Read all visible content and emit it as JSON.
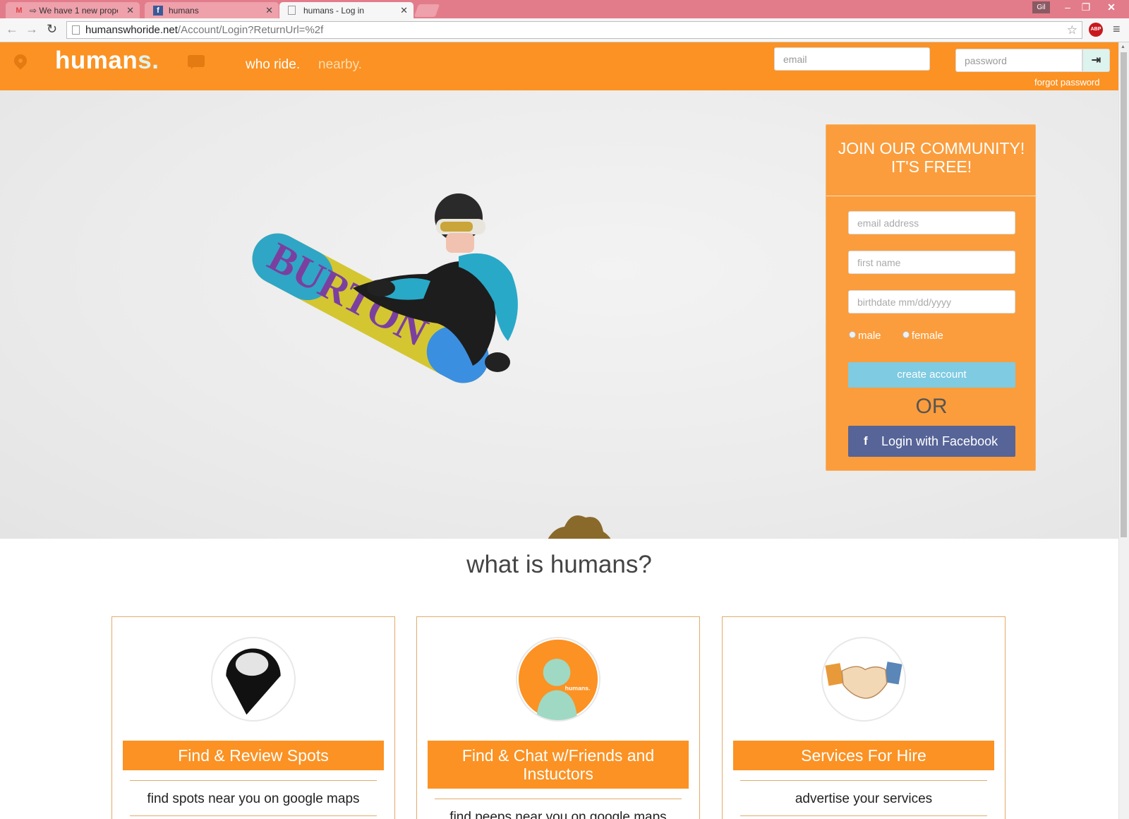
{
  "browser": {
    "tabs": [
      {
        "label": "⇨ We have 1 new proper",
        "favicon": "gmail-icon",
        "active": false
      },
      {
        "label": "humans",
        "favicon": "facebook-icon",
        "active": false
      },
      {
        "label": "humans - Log in",
        "favicon": "page-icon",
        "active": true
      }
    ],
    "user_badge": "Gil",
    "url_host": "humanswhoride.net",
    "url_path": "/Account/Login?ReturnUrl=%2f",
    "abp_label": "ABP"
  },
  "header": {
    "brand_main": "human",
    "brand_accent": "s.",
    "nav_who": "who ride.",
    "nav_nearby": "nearby.",
    "email_placeholder": "email",
    "password_placeholder": "password",
    "forgot_label": "forgot password"
  },
  "join": {
    "title_line1": "JOIN OUR COMMUNITY!",
    "title_line2": "IT'S FREE!",
    "email_placeholder": "email address",
    "firstname_placeholder": "first name",
    "birthdate_placeholder": "birthdate mm/dd/yyyy",
    "male_label": "male",
    "female_label": "female",
    "create_label": "create account",
    "or_label": "OR",
    "facebook_label": "Login with Facebook"
  },
  "hero": {
    "board_text": "BURTON"
  },
  "about": {
    "title": "what is humans?",
    "features": [
      {
        "title": "Find & Review Spots",
        "desc": "find spots near you on google maps"
      },
      {
        "title": "Find & Chat w/Friends and Instuctors",
        "desc": "find peeps near you on google maps"
      },
      {
        "title": "Services For Hire",
        "desc": "advertise your services"
      }
    ],
    "avatar_brand": "humans."
  },
  "colors": {
    "brand_orange": "#fb9223",
    "join_card": "#fb9d3c",
    "create_button": "#7ecbe2",
    "facebook_button": "#566498",
    "mint": "#ddf3ee"
  }
}
